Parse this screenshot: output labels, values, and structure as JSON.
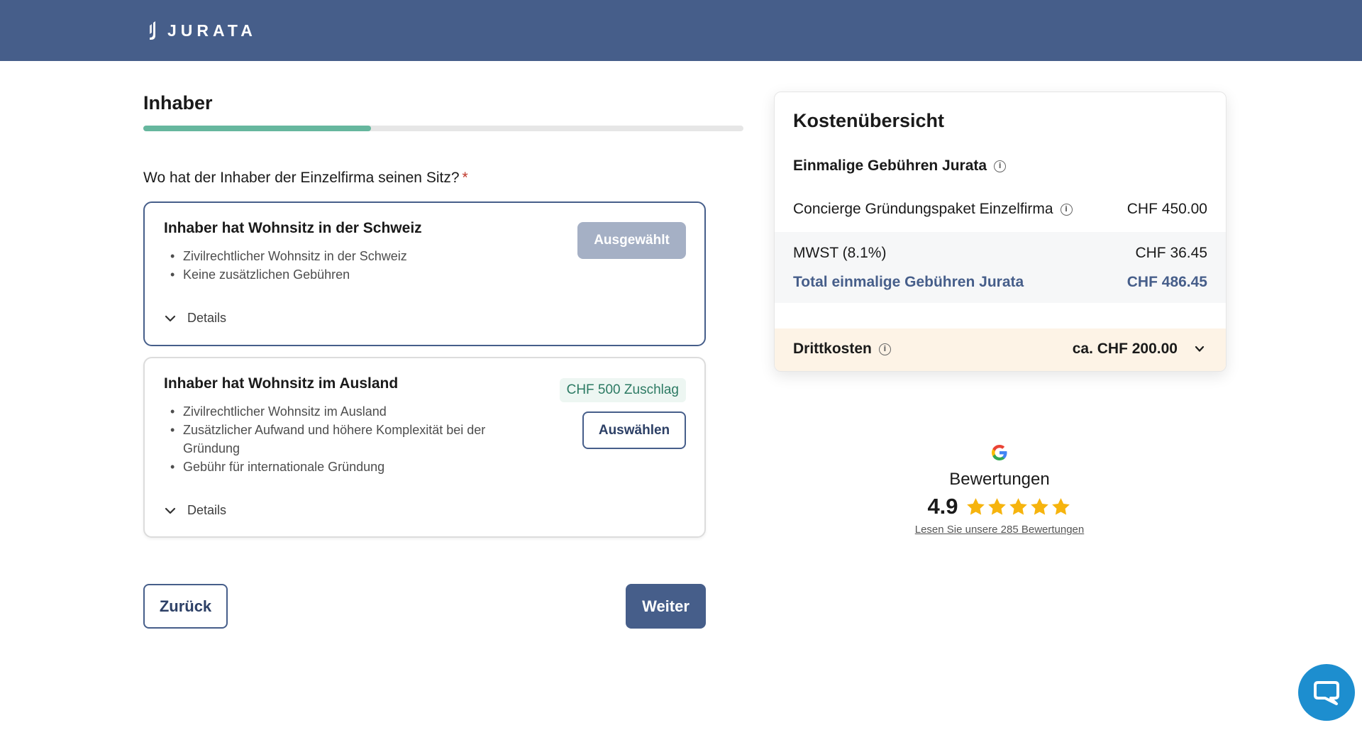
{
  "header": {
    "logo_text": "JURATA",
    "bg_color": "#465e8a"
  },
  "step": {
    "title": "Inhaber",
    "progress_percent": 38
  },
  "question": {
    "text": "Wo hat der Inhaber der Einzelfirma seinen Sitz?",
    "required_marker": "*"
  },
  "options": [
    {
      "title": "Inhaber hat Wohnsitz in der Schweiz",
      "bullets": [
        "Zivilrechtlicher Wohnsitz in der Schweiz",
        "Keine zusätzlichen Gebühren"
      ],
      "status_label": "Ausgewählt",
      "details_label": "Details",
      "selected": true
    },
    {
      "title": "Inhaber hat Wohnsitz im Ausland",
      "bullets": [
        "Zivilrechtlicher Wohnsitz im Ausland",
        "Zusätzlicher Aufwand und höhere Komplexität bei der Gründung",
        "Gebühr für internationale Gründung"
      ],
      "badge": "CHF 500 Zuschlag",
      "choose_label": "Auswählen",
      "details_label": "Details",
      "selected": false
    }
  ],
  "nav": {
    "back_label": "Zurück",
    "next_label": "Weiter"
  },
  "summary": {
    "title": "Kostenübersicht",
    "section_title": "Einmalige Gebühren Jurata",
    "items": [
      {
        "label": "Concierge Gründungspaket Einzelfirma",
        "value": "CHF 450.00"
      },
      {
        "label": "MWST (8.1%)",
        "value": "CHF 36.45"
      }
    ],
    "total": {
      "label": "Total einmalige Gebühren Jurata",
      "value": "CHF 486.45"
    },
    "third_party": {
      "label": "Drittkosten",
      "value": "ca. CHF 200.00"
    }
  },
  "reviews": {
    "label": "Bewertungen",
    "score": "4.9",
    "stars": 5,
    "link_text": "Lesen Sie unsere 285 Bewertungen"
  },
  "icons": {
    "chat": "chat-icon",
    "info": "info-icon",
    "chevron": "chevron-down-icon",
    "google": "google-icon",
    "star": "star-icon"
  }
}
